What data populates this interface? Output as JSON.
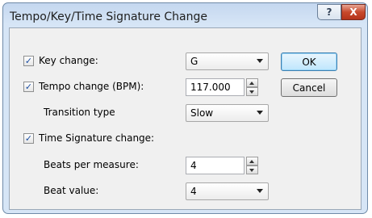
{
  "window": {
    "title": "Tempo/Key/Time Signature Change",
    "help_label": "?",
    "close_label": "X"
  },
  "key_change": {
    "label": "Key change:",
    "checked": true,
    "value": "G"
  },
  "tempo_change": {
    "label": "Tempo change (BPM):",
    "checked": true,
    "value": "117.000"
  },
  "transition": {
    "label": "Transition type",
    "value": "Slow"
  },
  "time_signature": {
    "label": "Time Signature change:",
    "checked": true
  },
  "beats_per_measure": {
    "label": "Beats per measure:",
    "value": "4"
  },
  "beat_value": {
    "label": "Beat value:",
    "value": "4"
  },
  "buttons": {
    "ok": "OK",
    "cancel": "Cancel"
  },
  "checkmark": "✓"
}
